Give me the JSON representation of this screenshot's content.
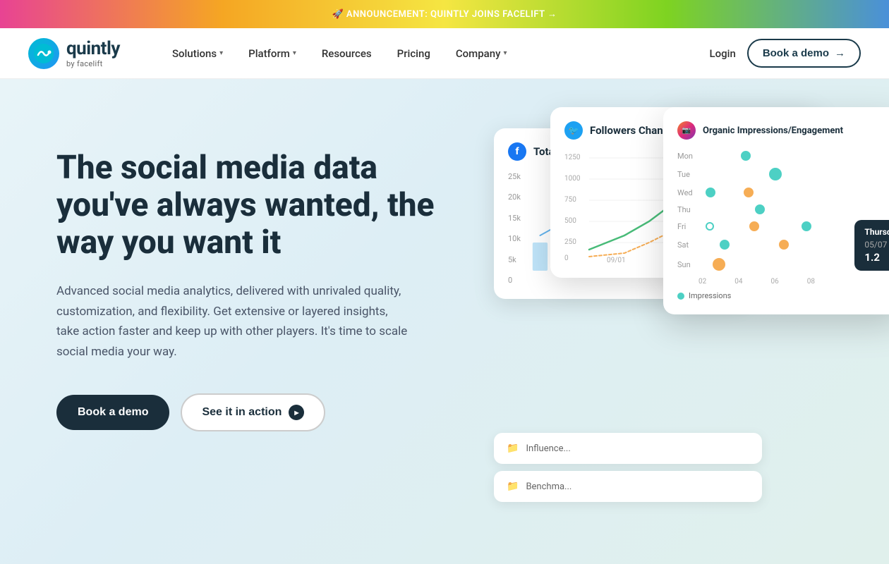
{
  "announcement": {
    "text": "🚀 ANNOUNCEMENT: QUINTLY JOINS FACELIFT →"
  },
  "header": {
    "logo_name": "quintly",
    "logo_sub": "by facelift",
    "nav": {
      "solutions": "Solutions",
      "platform": "Platform",
      "resources": "Resources",
      "pricing": "Pricing",
      "company": "Company",
      "login": "Login",
      "book_demo": "Book a demo"
    }
  },
  "hero": {
    "title": "The social media data you've always wanted, the way you want it",
    "description": "Advanced social media analytics, delivered with unrivaled quality, customization, and flexibility. Get extensive or layered insights, take action faster and keep up with other players. It's time to scale social media your way.",
    "btn_primary": "Book a demo",
    "btn_secondary": "See it in action"
  },
  "widgets": {
    "w1_title": "Total Interactions",
    "w2_title": "Followers Change Rate",
    "w3_title": "Organic Impressions/Engagement",
    "tooltip": {
      "title": "Thursday",
      "date": "05/07",
      "value": "1.2"
    },
    "days": [
      "Mon",
      "Tue",
      "Wed",
      "Thu",
      "Fri",
      "Sat",
      "Sun"
    ],
    "x_labels": [
      "02",
      "04",
      "06",
      "08"
    ],
    "y_labels_w1": [
      "25k",
      "20k",
      "15k",
      "10k",
      "5k",
      "0"
    ],
    "y_labels_w2": [
      "1250",
      "1000",
      "750",
      "500",
      "250",
      "0"
    ],
    "bottom_w1": "Influence...",
    "bottom_w2": "Benchma...",
    "legend_impressions": "Impressions"
  },
  "colors": {
    "primary_dark": "#1a2e3b",
    "accent_blue": "#3182ce",
    "accent_teal": "#4dd0c4",
    "accent_orange": "#f6ad55",
    "bg_light": "#e8f4f8"
  }
}
